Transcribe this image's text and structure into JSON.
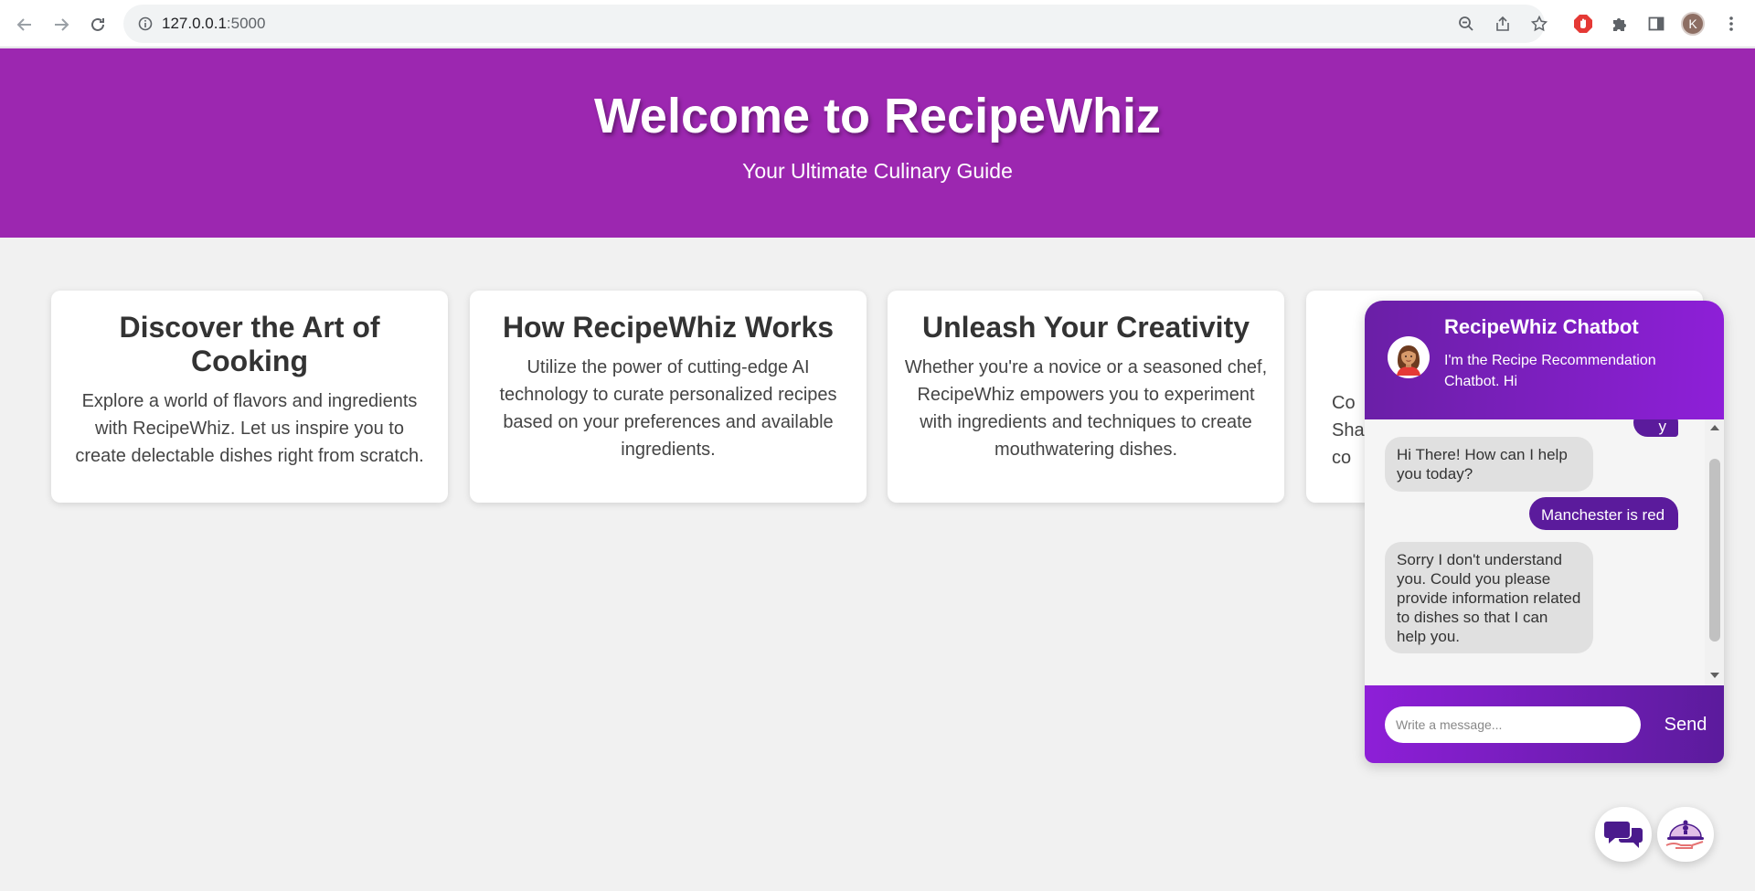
{
  "browser": {
    "url_host": "127.0.0.1",
    "url_port": ":5000",
    "profile_initial": "K"
  },
  "hero": {
    "title": "Welcome to RecipeWhiz",
    "subtitle": "Your Ultimate Culinary Guide"
  },
  "cards": [
    {
      "title": "Discover the Art of Cooking",
      "text": "Explore a world of flavors and ingredients with RecipeWhiz. Let us inspire you to create delectable dishes right from scratch."
    },
    {
      "title": "How RecipeWhiz Works",
      "text": "Utilize the power of cutting-edge AI technology to curate personalized recipes based on your preferences and available ingredients."
    },
    {
      "title": "Unleash Your Creativity",
      "text": "Whether you're a novice or a seasoned chef, RecipeWhiz empowers you to experiment with ingredients and techniques to create mouthwatering dishes."
    },
    {
      "title": "",
      "text": "Co\nSha\nco"
    }
  ],
  "chatbot": {
    "title": "RecipeWhiz Chatbot",
    "description": "I'm the Recipe Recommendation Chatbot. Hi",
    "messages": [
      {
        "from": "user",
        "text": "y"
      },
      {
        "from": "bot",
        "text": "Hi There! How can I help you today?"
      },
      {
        "from": "user",
        "text": "Manchester is red"
      },
      {
        "from": "bot",
        "text": "Sorry I don't understand you. Could you please provide information related to dishes so that I can help you."
      }
    ],
    "input_placeholder": "Write a message...",
    "send_label": "Send"
  },
  "colors": {
    "hero_bg": "#9c27b0",
    "user_bubble": "#5b1b9c",
    "bot_bubble": "#e0e0e0"
  },
  "icons": {
    "chat_fab": "chat-bubbles-icon",
    "recipe_fab": "chef-cloche-icon"
  }
}
